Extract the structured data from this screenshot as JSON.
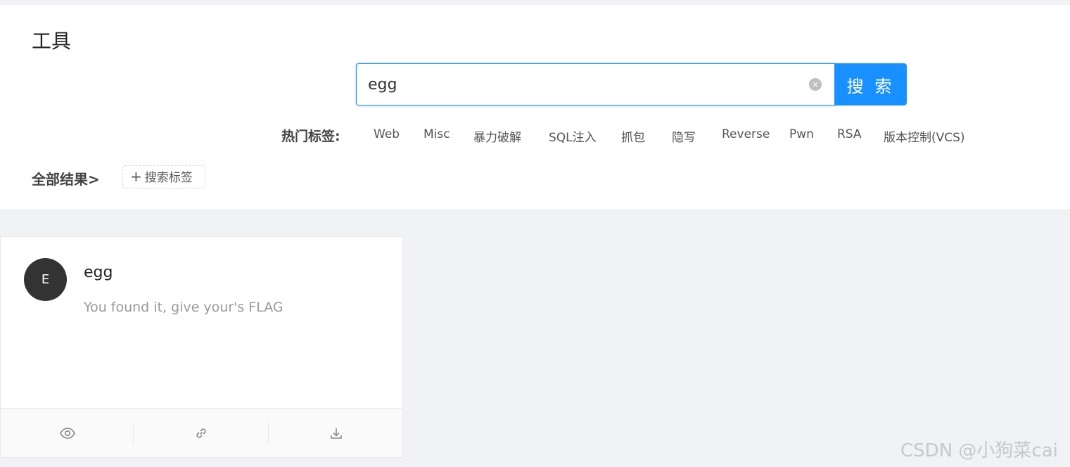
{
  "header": {
    "title": "工具"
  },
  "search": {
    "value": "egg",
    "button_label": "搜 索"
  },
  "hot_tags": {
    "label": "热门标签:",
    "tags": [
      "Web",
      "Misc",
      "暴力破解",
      "SQL注入",
      "抓包",
      "隐写",
      "Reverse",
      "Pwn",
      "RSA",
      "版本控制(VCS)"
    ]
  },
  "filter": {
    "all_results_label": "全部结果>",
    "add_tag_label": "搜索标签"
  },
  "results": [
    {
      "avatar_letter": "E",
      "title": "egg",
      "description": "You found it, give your's FLAG",
      "actions": [
        "eye-icon",
        "link-icon",
        "download-icon"
      ]
    }
  ],
  "watermark": "CSDN @小狗菜cai",
  "colors": {
    "primary": "#1890ff",
    "avatar_bg": "#333333",
    "page_bg": "#f0f2f5"
  }
}
